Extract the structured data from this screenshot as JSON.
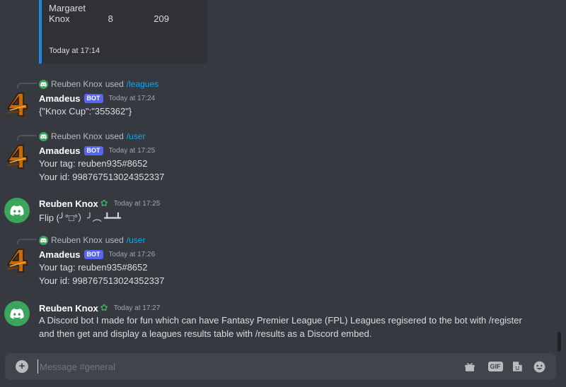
{
  "embed": {
    "row": {
      "name": "Margaret Knox",
      "rank": "8",
      "points": "209"
    },
    "footer": "Today at 17:14"
  },
  "messages": [
    {
      "reply": {
        "user": "Reuben Knox",
        "used": "used",
        "command": "/leagues"
      },
      "author": "Amadeus",
      "bot_tag": "BOT",
      "timestamp": "Today at 17:24",
      "lines": [
        "{\"Knox Cup\":\"355362\"}"
      ]
    },
    {
      "reply": {
        "user": "Reuben Knox",
        "used": "used",
        "command": "/user"
      },
      "author": "Amadeus",
      "bot_tag": "BOT",
      "timestamp": "Today at 17:25",
      "lines": [
        "Your tag: reuben935#8652",
        "Your id: 998767513024352337"
      ]
    },
    {
      "author": "Reuben Knox",
      "timestamp": "Today at 17:25",
      "lines": [
        "Flip (╯°□°）╯︵ ┻━┻"
      ]
    },
    {
      "reply": {
        "user": "Reuben Knox",
        "used": "used",
        "command": "/user"
      },
      "author": "Amadeus",
      "bot_tag": "BOT",
      "timestamp": "Today at 17:26",
      "lines": [
        "Your tag: reuben935#8652",
        "Your id: 998767513024352337"
      ]
    },
    {
      "author": "Reuben Knox",
      "timestamp": "Today at 17:27",
      "lines": [
        "A Discord bot I made for fun which can have Fantasy Premier League (FPL) Leagues regisered to the bot with /register and then get and display a leagues results table with /results as a Discord embed."
      ]
    }
  ],
  "composer": {
    "placeholder": "Message #general",
    "icons": [
      "add-icon",
      "gift-icon",
      "gif-icon",
      "sticker-icon",
      "emoji-icon"
    ],
    "gif_label": "GIF"
  },
  "colors": {
    "background": "#36393f",
    "embed_accent": "#1e88e5",
    "bot_tag": "#5865f2",
    "link": "#00aff4",
    "discord_green": "#3ba55c"
  }
}
